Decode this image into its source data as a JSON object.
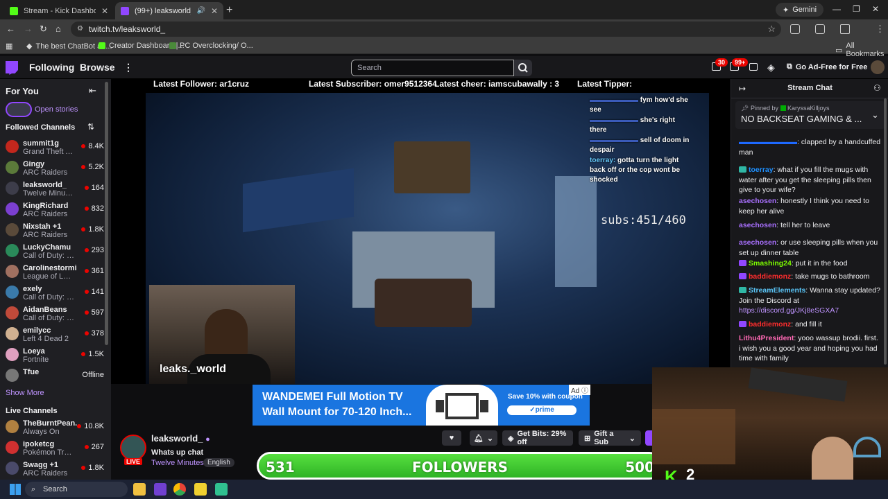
{
  "browser": {
    "tabs": [
      {
        "title": "Stream - Kick Dashboard",
        "favicon_color": "#53fc18"
      },
      {
        "title": "(99+) leaksworld_ - Twitch",
        "favicon_color": "#9147ff"
      }
    ],
    "gemini_label": "Gemini",
    "url": "twitch.tv/leaksworld_",
    "bookmarks": [
      "The best ChatBot an...",
      "Creator Dashboard |...",
      "PC Overclocking/ O..."
    ],
    "all_bookmarks_label": "All Bookmarks"
  },
  "twitch_nav": {
    "following": "Following",
    "browse": "Browse",
    "search_placeholder": "Search",
    "inbox_badge": "30",
    "notif_badge": "99+",
    "ad_free": "Go Ad-Free for Free"
  },
  "sidebar": {
    "for_you": "For You",
    "open_stories": "Open stories",
    "followed_header": "Followed Channels",
    "followed": [
      {
        "name": "summit1g",
        "game": "Grand Theft A...",
        "viewers": "8.4K",
        "avatar": "#c2271d"
      },
      {
        "name": "Gingy",
        "game": "ARC Raiders",
        "viewers": "5.2K",
        "avatar": "#5b7a3a"
      },
      {
        "name": "leaksworld_",
        "game": "Twelve Minutes",
        "viewers": "164",
        "avatar": "#3d3d4a"
      },
      {
        "name": "KingRichard",
        "game": "ARC Raiders",
        "viewers": "832",
        "avatar": "#7b3fd0"
      },
      {
        "name": "Nixstah +1",
        "game": "ARC Raiders",
        "viewers": "1.8K",
        "avatar": "#5a4a3a"
      },
      {
        "name": "LuckyChamu",
        "game": "Call of Duty: W...",
        "viewers": "293",
        "avatar": "#2a8a5a"
      },
      {
        "name": "Carolinestormi",
        "game": "League of Lege...",
        "viewers": "361",
        "avatar": "#a07060"
      },
      {
        "name": "exely",
        "game": "Call of Duty: W...",
        "viewers": "141",
        "avatar": "#3a7aaa"
      },
      {
        "name": "AidanBeans",
        "game": "Call of Duty: W...",
        "viewers": "597",
        "avatar": "#c04a3a"
      },
      {
        "name": "emilycc",
        "game": "Left 4 Dead 2",
        "viewers": "378",
        "avatar": "#d0b090"
      },
      {
        "name": "Loeya",
        "game": "Fortnite",
        "viewers": "1.5K",
        "avatar": "#e0a0c0"
      },
      {
        "name": "Tfue",
        "game": "",
        "viewers": "Offline",
        "avatar": "#777777"
      }
    ],
    "show_more": "Show More",
    "live_header": "Live Channels",
    "live": [
      {
        "name": "TheBurntPean...",
        "game": "Always On",
        "viewers": "10.8K",
        "avatar": "#b08040"
      },
      {
        "name": "ipoketcg",
        "game": "Pokémon Tradi...",
        "viewers": "267",
        "avatar": "#d03030"
      },
      {
        "name": "Swagg +1",
        "game": "ARC Raiders",
        "viewers": "1.8K",
        "avatar": "#4a4a6a"
      }
    ]
  },
  "stream": {
    "overlay": {
      "latest_follower": "Latest Follower: ar1cruz",
      "latest_subscriber": "Latest Subscriber: omer9512364",
      "latest_cheer": "Latest cheer: iamscubawally : 3",
      "latest_tipper": "Latest Tipper:",
      "chat": [
        {
          "user": "",
          "text": "fym how'd she see"
        },
        {
          "user": "",
          "text": "she's right there"
        },
        {
          "user": "",
          "text": "sell of doom in despair"
        },
        {
          "user": "toerray:",
          "text": "gotta turn the light back off or the cop wont be shocked"
        }
      ],
      "subs_goal": "subs:451/460",
      "cam_name": "leaks._world"
    },
    "ad": {
      "line1": "WANDEMEI Full Motion TV",
      "line2": "Wall Mount for 70-120 Inch...",
      "save": "Save 10% with coupon",
      "prime": "✓prime",
      "label": "Ad"
    },
    "channel": {
      "name": "leaksworld_",
      "live": "LIVE",
      "title": "Whats up chat",
      "game": "Twelve Minutes",
      "tag": "English",
      "get_bits": "Get Bits: 29% off",
      "gift_sub": "Gift a Sub"
    },
    "followers_bar": {
      "current": "531",
      "label": "FOLLOWERS",
      "goal": "500",
      "progress": 1.0
    },
    "kick_viewers": "2"
  },
  "chat": {
    "title": "Stream Chat",
    "pinned_by": "Pinned by",
    "pinned_user": "KaryssaKilljoys",
    "pinned_message": "NO BACKSEAT GAMING & ...",
    "messages": [
      {
        "user": "",
        "color": "#1e69ff",
        "text": "clapped by a handcuffed man",
        "badge": ""
      },
      {
        "user": "toerray",
        "color": "#1e90ff",
        "text": "what if you fill the mugs with water after you get the sleeping pills then give to your wife?",
        "badge": "#2fb7a5"
      },
      {
        "user": "asechosen",
        "color": "#a970ff",
        "text": "honestly I think you need to keep her alive",
        "badge": ""
      },
      {
        "user": "asechosen",
        "color": "#a970ff",
        "text": "tell her to leave",
        "badge": ""
      },
      {
        "user": "asechosen",
        "color": "#a970ff",
        "text": "or use sleeping pills when you set up dinner table",
        "badge": ""
      },
      {
        "user": "Smashing24",
        "color": "#7cfc00",
        "text": "put it in the food",
        "badge": "#9147ff"
      },
      {
        "user": "baddiemonz",
        "color": "#ff2d2d",
        "text": "take mugs to bathroom",
        "badge": "#9147ff"
      },
      {
        "user": "StreamElements",
        "color": "#5bc8fb",
        "text": "Wanna stay updated? Join the Discord at",
        "link": "https://discord.gg/JKj8eSGXA7",
        "badge": "#2fb7a5"
      },
      {
        "user": "baddiemonz",
        "color": "#ff2d2d",
        "text": "and fill it",
        "badge": "#9147ff"
      },
      {
        "user": "Lithu4President",
        "color": "#ff69b4",
        "text": "yooo wassup brodii. first. i wish you a good year and hoping you had time with family",
        "badge": ""
      }
    ]
  },
  "taskbar": {
    "search": "Search"
  }
}
